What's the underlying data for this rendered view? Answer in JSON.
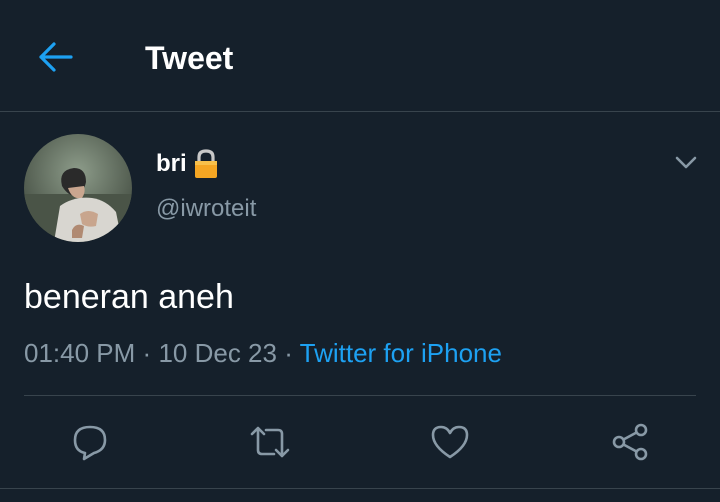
{
  "header": {
    "title": "Tweet",
    "back_icon": "arrow-left-icon"
  },
  "tweet": {
    "display_name": "bri",
    "lock_icon": "lock-emoji-icon",
    "handle": "@iwroteit",
    "text": "beneran aneh",
    "time": "01:40 PM",
    "separator": "·",
    "date": "10 Dec 23",
    "source": "Twitter for iPhone"
  },
  "actions": [
    {
      "name": "reply",
      "icon": "reply-icon"
    },
    {
      "name": "retweet",
      "icon": "retweet-icon"
    },
    {
      "name": "like",
      "icon": "heart-icon"
    },
    {
      "name": "share",
      "icon": "share-icon"
    }
  ],
  "colors": {
    "background": "#15202b",
    "accent": "#1da1f2",
    "secondary_text": "#8899a6",
    "divider": "#38444d"
  }
}
